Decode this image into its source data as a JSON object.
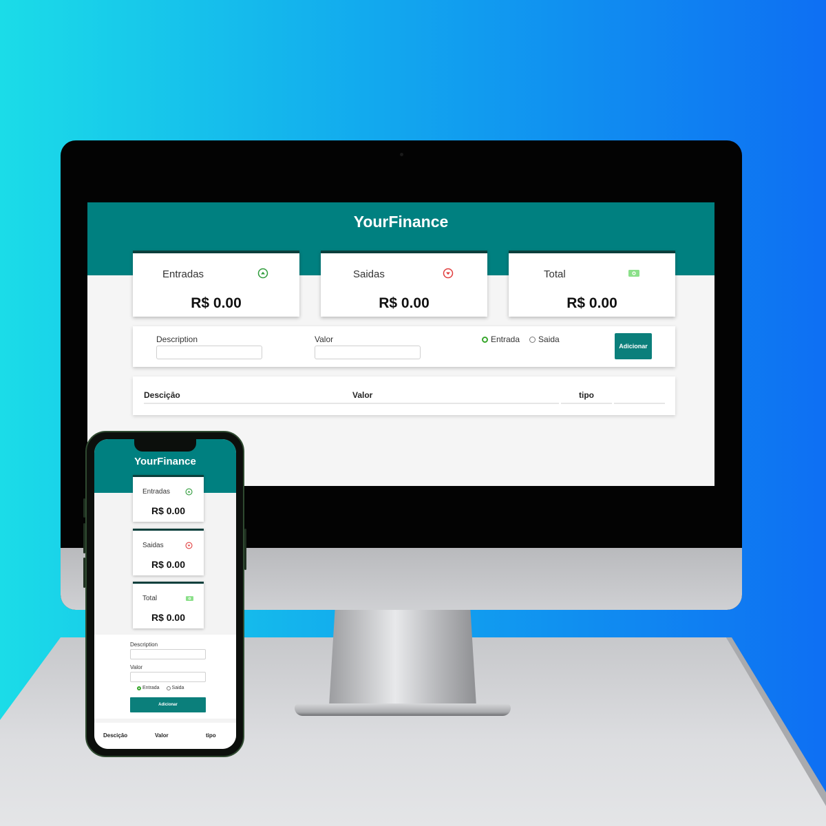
{
  "app": {
    "title": "YourFinance"
  },
  "summary": {
    "income": {
      "label": "Entradas",
      "value": "R$ 0.00",
      "icon": "arrow-up-circle-icon",
      "color": "#2e9b3a"
    },
    "expense": {
      "label": "Saidas",
      "value": "R$ 0.00",
      "icon": "arrow-down-circle-icon",
      "color": "#e03c3c"
    },
    "total": {
      "label": "Total",
      "value": "R$ 0.00",
      "icon": "money-bill-icon",
      "color": "#8be08a"
    }
  },
  "form": {
    "description_label": "Description",
    "description_value": "",
    "value_label": "Valor",
    "value_value": "",
    "type_options": [
      "Entrada",
      "Saida"
    ],
    "selected_type": "Entrada",
    "submit_label": "Adicionar"
  },
  "table": {
    "columns": [
      "Desciçāo",
      "Valor",
      "tipo"
    ],
    "rows": []
  },
  "theme": {
    "primary": "#008080",
    "card_border": "#0b3f3c",
    "radio_checked": "#37a62b"
  }
}
